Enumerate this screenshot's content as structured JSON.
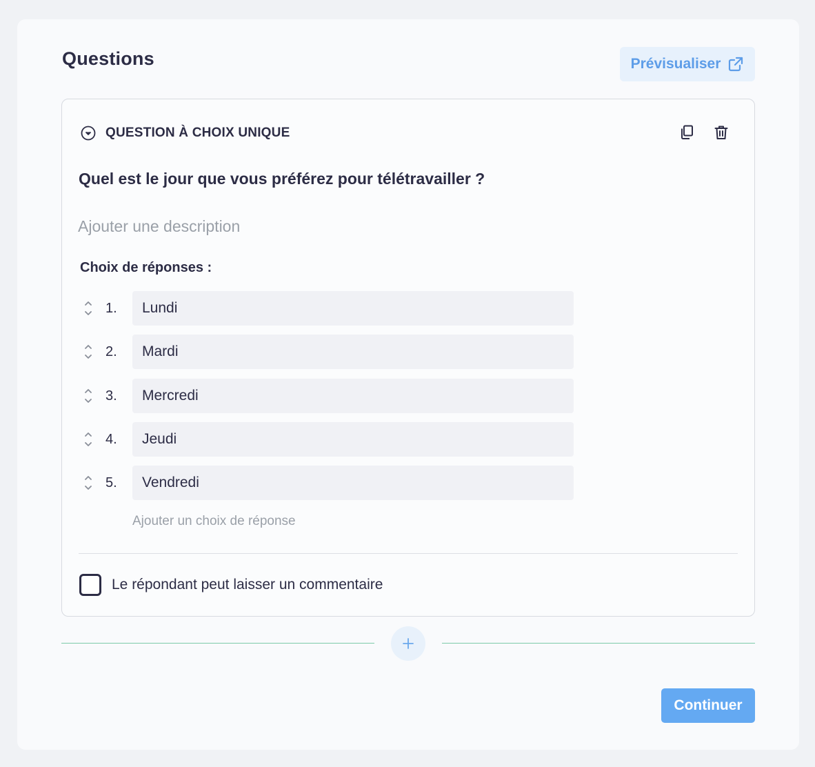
{
  "page": {
    "title": "Questions",
    "preview_label": "Prévisualiser"
  },
  "question": {
    "type_label": "QUESTION À CHOIX UNIQUE",
    "text": "Quel est le jour que vous préférez pour télétravailler ?",
    "description_placeholder": "Ajouter une description",
    "choices_label": "Choix de réponses :",
    "choices": [
      {
        "number": "1.",
        "value": "Lundi"
      },
      {
        "number": "2.",
        "value": "Mardi"
      },
      {
        "number": "3.",
        "value": "Mercredi"
      },
      {
        "number": "4.",
        "value": "Jeudi"
      },
      {
        "number": "5.",
        "value": "Vendredi"
      }
    ],
    "add_choice_label": "Ajouter un choix de réponse",
    "comment_label": "Le répondant peut laisser un commentaire",
    "comment_checked": false
  },
  "footer": {
    "continue_label": "Continuer"
  },
  "icons": {
    "type": "chevron-down-circle-icon",
    "duplicate": "copy-icon",
    "delete": "trash-icon",
    "preview": "external-link-icon",
    "drag": "drag-handle-icon",
    "add": "plus-icon"
  },
  "colors": {
    "accent": "#64a9f2",
    "accent_light": "#e7f1fc",
    "text": "#2c2c45",
    "muted": "#9aa0a8",
    "separator": "#7cc9a8"
  }
}
